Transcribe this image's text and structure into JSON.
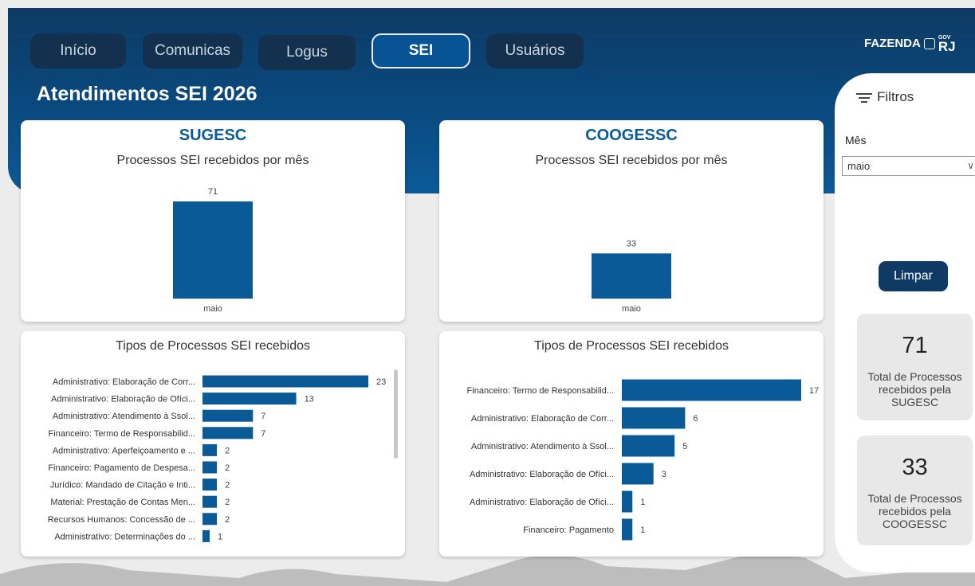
{
  "nav": {
    "tabs": [
      {
        "label": "Início"
      },
      {
        "label": "Comunicas"
      },
      {
        "label": "Logus"
      },
      {
        "label": "SEI"
      },
      {
        "label": "Usuários"
      }
    ],
    "active": "SEI"
  },
  "brand": {
    "name": "FAZENDA",
    "gov": "GOV",
    "state": "RJ"
  },
  "page_title": "Atendimentos SEI 2026",
  "filters": {
    "title": "Filtros",
    "mes_label": "Mês",
    "mes_value": "maio",
    "clear_label": "Limpar"
  },
  "kpis": [
    {
      "value": "71",
      "label": "Total de Processos recebidos pela SUGESC"
    },
    {
      "value": "33",
      "label": "Total de Processos recebidos pela COOGESSC"
    }
  ],
  "sections": [
    {
      "name": "SUGESC",
      "monthly_title": "Processos SEI recebidos por mês",
      "types_title": "Tipos de Processos SEI recebidos"
    },
    {
      "name": "COOGESSC",
      "monthly_title": "Processos SEI recebidos por mês",
      "types_title": "Tipos de Processos SEI recebidos"
    }
  ],
  "colors": {
    "bar": "#0b5a98",
    "navy": "#0e3a64",
    "accent": "#075394"
  },
  "chart_data": [
    {
      "type": "bar",
      "title": "Processos SEI recebidos por mês",
      "categories": [
        "maio"
      ],
      "values": [
        71
      ]
    },
    {
      "type": "bar",
      "title": "Processos SEI recebidos por mês",
      "categories": [
        "maio"
      ],
      "values": [
        33
      ]
    },
    {
      "type": "bar",
      "orientation": "horizontal",
      "title": "Tipos de Processos SEI recebidos",
      "categories": [
        "Administrativo: Elaboração de Corr...",
        "Administrativo: Elaboração de Ofíci...",
        "Administrativo: Atendimento à Ssol...",
        "Financeiro: Termo de Responsabilid...",
        "Administrativo: Aperfeiçoamento e ...",
        "Financeiro: Pagamento de Despesa...",
        "Jurídico: Mandado de Citação e Inti...",
        "Material: Prestação de Contas Men...",
        "Recursos Humanos: Concessão de ...",
        "Administrativo: Determinações do ..."
      ],
      "values": [
        23,
        13,
        7,
        7,
        2,
        2,
        2,
        2,
        2,
        1
      ]
    },
    {
      "type": "bar",
      "orientation": "horizontal",
      "title": "Tipos de Processos SEI recebidos",
      "categories": [
        "Financeiro: Termo de Responsabilid...",
        "Administrativo: Elaboração de Corr...",
        "Administrativo: Atendimento à Ssol...",
        "Administrativo: Elaboração de Ofíci...",
        "Administrativo: Elaboração de Ofíci...",
        "Financeiro: Pagamento"
      ],
      "values": [
        17,
        6,
        5,
        3,
        1,
        1
      ]
    }
  ]
}
